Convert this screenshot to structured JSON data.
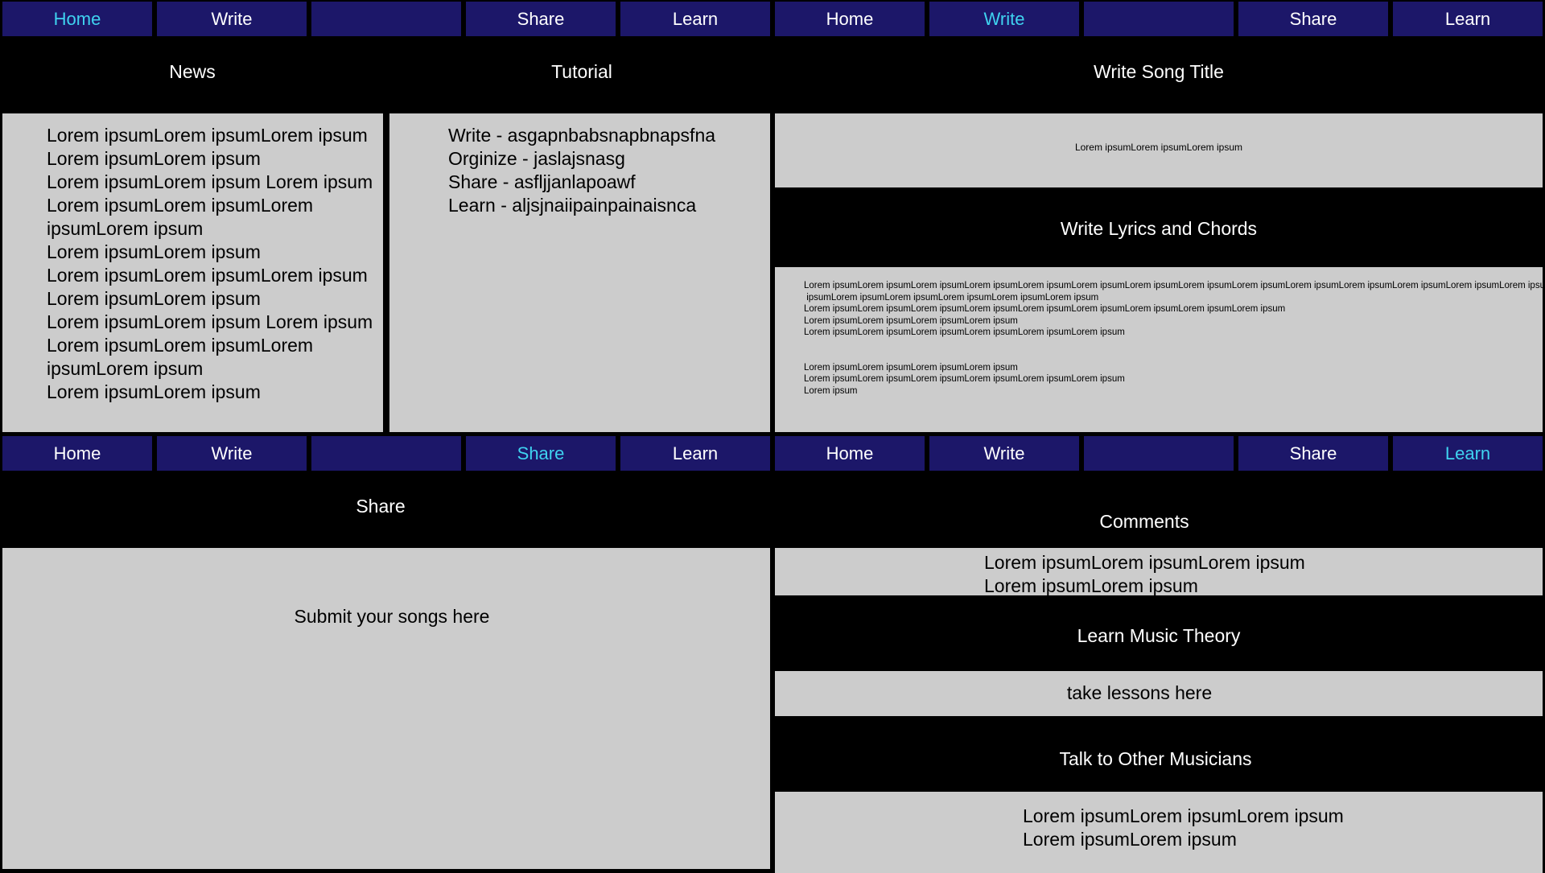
{
  "colors": {
    "nav_bg": "#1c1769",
    "nav_active_text": "#3fd3f0",
    "page_bg": "#000000",
    "panel_bg": "#cccccc"
  },
  "screens": {
    "home": {
      "nav": [
        "Home",
        "Write",
        "",
        "Share",
        "Learn"
      ],
      "active_tab": "Home",
      "news_title": "News",
      "news_items": [
        "Lorem ipsumLorem ipsumLorem ipsum",
        "Lorem ipsumLorem ipsum",
        "Lorem ipsumLorem ipsum Lorem ipsum",
        "Lorem ipsumLorem ipsumLorem",
        "ipsumLorem ipsum",
        "Lorem ipsumLorem ipsum",
        "Lorem ipsumLorem ipsumLorem ipsum",
        "Lorem ipsumLorem ipsum",
        "Lorem ipsumLorem ipsum Lorem ipsum",
        "Lorem ipsumLorem ipsumLorem",
        "ipsumLorem ipsum",
        "Lorem ipsumLorem ipsum"
      ],
      "tutorial_title": "Tutorial",
      "tutorial_items": [
        "Write - asgapnbabsnapbnapsfna",
        "Orginize - jaslajsnasg",
        "Share - asfljjanlapoawf",
        "Learn - aljsjnaiipainpainaisnca"
      ]
    },
    "write": {
      "nav": [
        "Home",
        "Write",
        "",
        "Share",
        "Learn"
      ],
      "active_tab": "Write",
      "song_title_heading": "Write Song Title",
      "song_title_text": "Lorem ipsumLorem ipsumLorem ipsum",
      "lyrics_heading": "Write Lyrics and Chords",
      "lyrics_text": "Lorem ipsumLorem ipsumLorem ipsumLorem ipsumLorem ipsumLorem ipsumLorem ipsumLorem ipsumLorem ipsumLorem ipsumLorem ipsumLorem ipsumLorem ipsumLorem ipsum\n ipsumLorem ipsumLorem ipsumLorem ipsumLorem ipsumLorem ipsum\nLorem ipsumLorem ipsumLorem ipsumLorem ipsumLorem ipsumLorem ipsumLorem ipsumLorem ipsumLorem ipsum\nLorem ipsumLorem ipsumLorem ipsumLorem ipsum\nLorem ipsumLorem ipsumLorem ipsumLorem ipsumLorem ipsumLorem ipsum\n\n\nLorem ipsumLorem ipsumLorem ipsumLorem ipsum\nLorem ipsumLorem ipsumLorem ipsumLorem ipsumLorem ipsumLorem ipsum\nLorem ipsum"
    },
    "share": {
      "nav": [
        "Home",
        "Write",
        "",
        "Share",
        "Learn"
      ],
      "active_tab": "Share",
      "heading": "Share",
      "submit_text": "Submit your songs here"
    },
    "learn": {
      "nav": [
        "Home",
        "Write",
        "",
        "Share",
        "Learn"
      ],
      "active_tab": "Learn",
      "comments_heading": "Comments",
      "comments_text": "Lorem ipsumLorem ipsumLorem ipsum\nLorem ipsumLorem ipsum",
      "theory_heading": "Learn Music Theory",
      "lessons_text": "take lessons here",
      "musicians_heading": "Talk to Other Musicians",
      "musicians_text": "Lorem ipsumLorem ipsumLorem ipsum\nLorem ipsumLorem ipsum"
    }
  }
}
